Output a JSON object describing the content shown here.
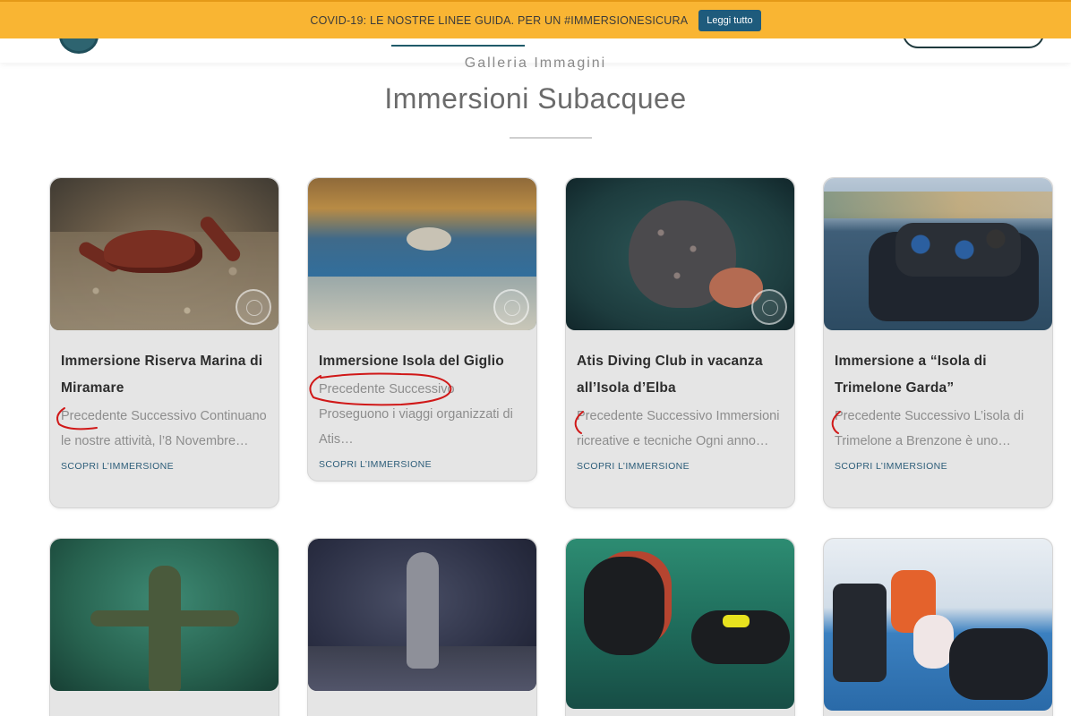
{
  "banner": {
    "text": "COVID-19: LE NOSTRE LINEE GUIDA. PER UN #IMMERSIONESICURA",
    "button_label": "Leggi tutto"
  },
  "section": {
    "kicker": "Galleria Immagini",
    "title": "Immersioni Subacquee"
  },
  "cards": [
    {
      "title": "Immersione Riserva Marina di Miramare",
      "excerpt": "Precedente Successivo Continuano le nostre attività, l’8 Novembre…",
      "link": "SCOPRI L’IMMERSIONE",
      "image": "crab-on-seabed"
    },
    {
      "title": "Immersione Isola del Giglio",
      "excerpt": "Precedente Successivo Proseguono i viaggi organizzati di Atis…",
      "link": "SCOPRI L’IMMERSIONE",
      "image": "fish-in-cave"
    },
    {
      "title": "Atis Diving Club in vacanza all’Isola d’Elba",
      "excerpt": "Precedente Successivo Immersioni ricreative e tecniche Ogni anno…",
      "link": "SCOPRI L’IMMERSIONE",
      "image": "grouper"
    },
    {
      "title": "Immersione a “Isola di Trimelone Garda”",
      "excerpt": "Precedente Successivo L’isola di Trimelone a Brenzone è uno…",
      "link": "SCOPRI L’IMMERSIONE",
      "image": "divers-on-boat"
    }
  ],
  "row2_images": [
    "christ-of-the-abyss",
    "underwater-madonna",
    "divers-on-wreck",
    "pool-with-baby"
  ],
  "colors": {
    "banner": "#f9b533",
    "banner_button": "#1e5b7c",
    "card_bg": "#e5e5e5",
    "link": "#2c5d79",
    "annotation": "#d01818"
  }
}
